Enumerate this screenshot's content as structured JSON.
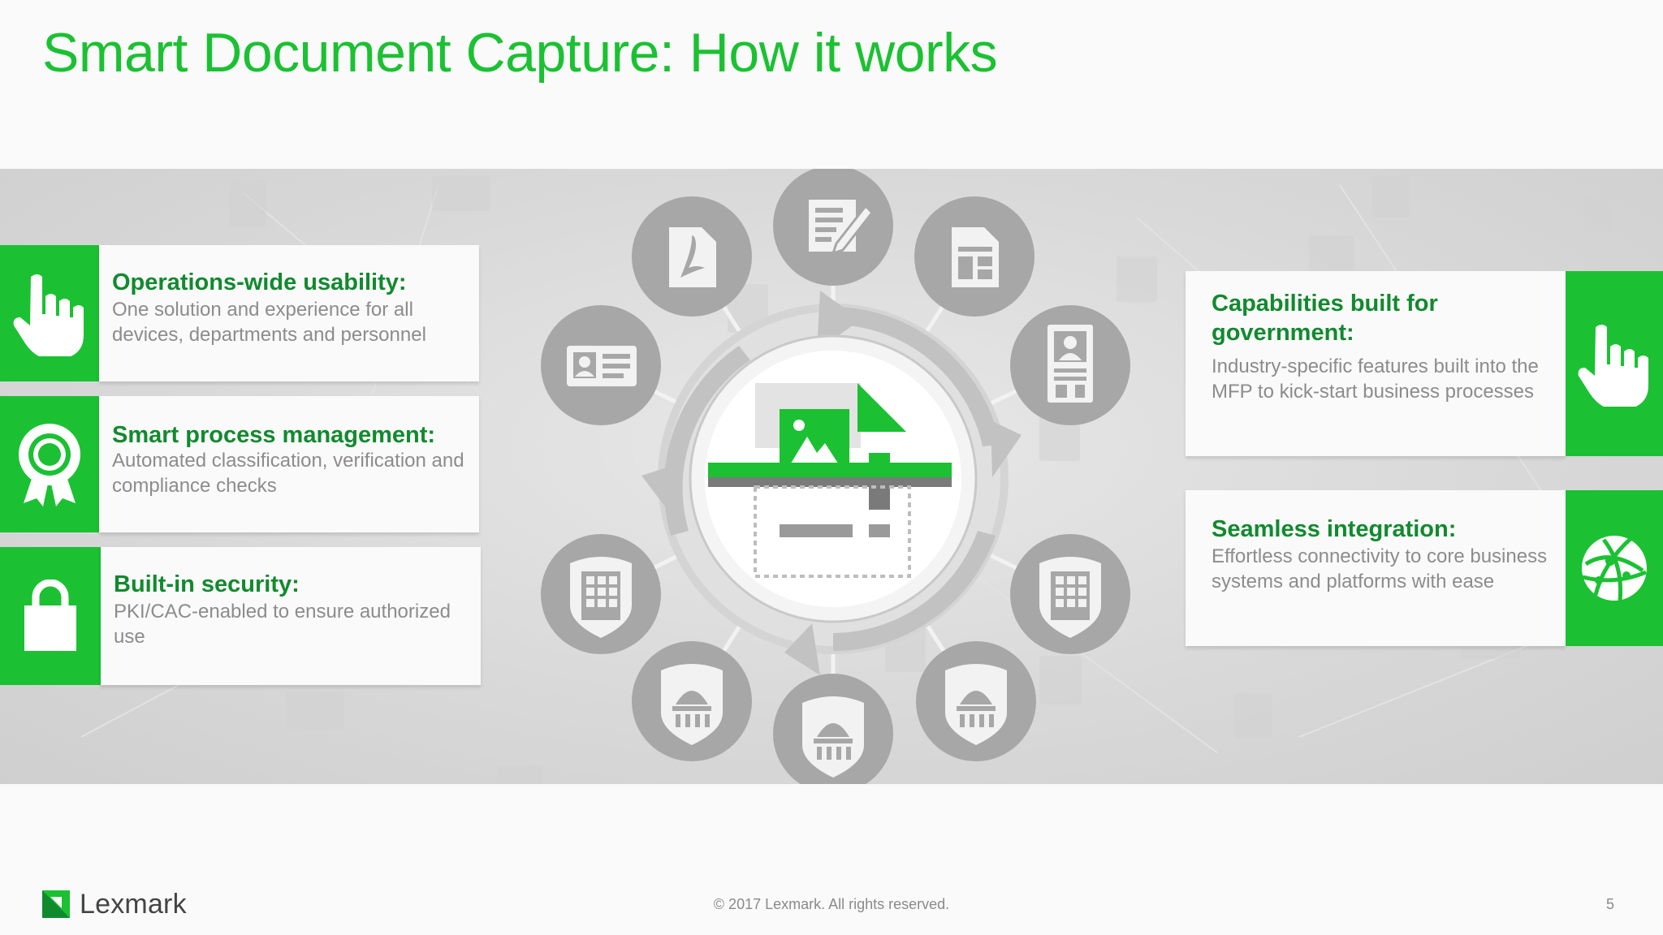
{
  "slide": {
    "title": "Smart Document Capture: How it works",
    "accent_color": "#1bc132",
    "heading_color": "#118a2e"
  },
  "left_features": [
    {
      "heading": "Operations-wide usability:",
      "body": "One solution and experience for all devices, departments and personnel",
      "icon": "hand-pointer-icon"
    },
    {
      "heading": "Smart process management:",
      "body": "Automated classification, verification and compliance checks",
      "icon": "award-ribbon-icon"
    },
    {
      "heading": "Built-in security:",
      "body": "PKI/CAC-enabled to ensure authorized use",
      "icon": "padlock-icon"
    }
  ],
  "right_features": [
    {
      "heading": "Capabilities built for government:",
      "body": "Industry-specific features built into the MFP to kick-start business processes",
      "icon": "hand-pointer-icon"
    },
    {
      "heading": "Seamless integration:",
      "body": "Effortless connectivity to core business systems and platforms with ease",
      "icon": "globe-network-icon"
    }
  ],
  "diagram": {
    "center_icon": "document-scanner-icon",
    "satellites": [
      "pdf-document-icon",
      "edit-form-icon",
      "layout-document-icon",
      "id-badge-icon",
      "building-shield-icon",
      "capitol-shield-icon",
      "capitol-shield-icon",
      "capitol-shield-icon",
      "building-shield-icon",
      "id-card-icon"
    ]
  },
  "footer": {
    "brand": "Lexmark",
    "copyright": "© 2017 Lexmark. All rights reserved.",
    "page_number": "5"
  }
}
